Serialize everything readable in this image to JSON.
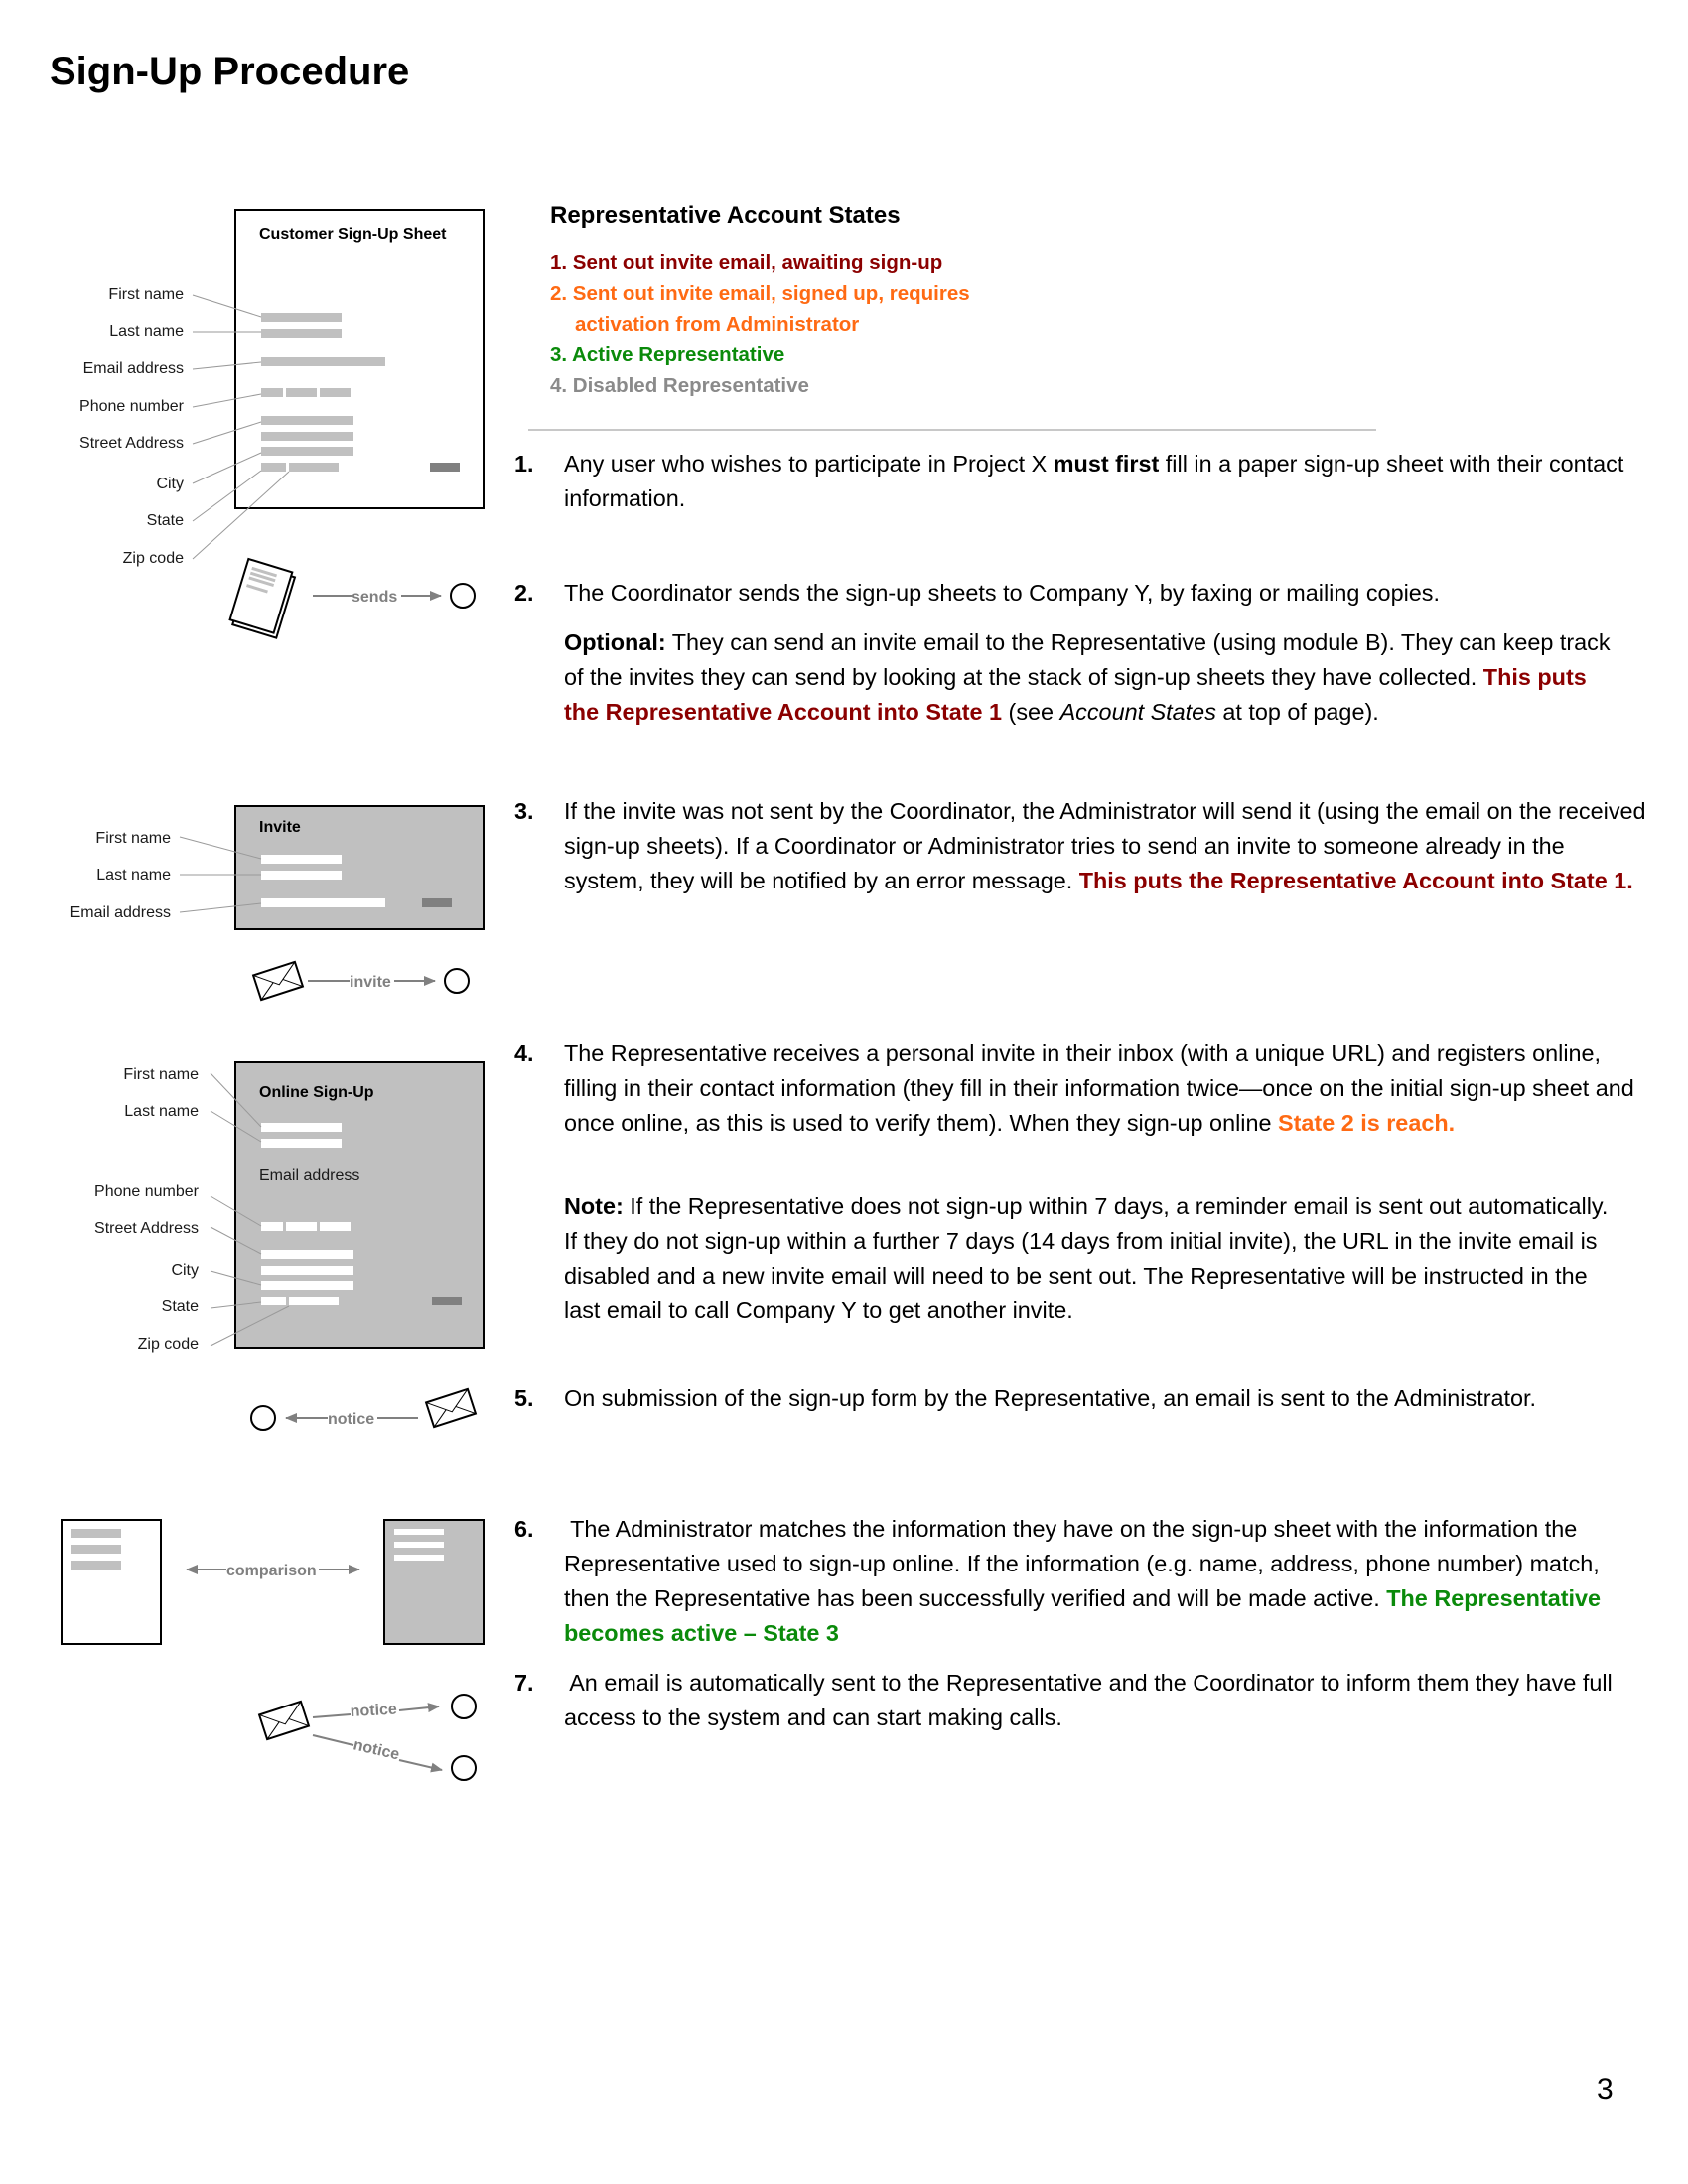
{
  "page": {
    "title": "Sign-Up Procedure",
    "page_number": "3"
  },
  "account_states": {
    "heading": "Representative Account States",
    "items": [
      {
        "text": "1. Sent out invite email, awaiting sign-up",
        "color": "#8b0000"
      },
      {
        "text_line1": "2. Sent out invite email, signed up, requires",
        "text_line2": "activation from Administrator",
        "color": "#ff6a13"
      },
      {
        "text": "3. Active Representative",
        "color": "#0a8a0a"
      },
      {
        "text": "4. Disabled Representative",
        "color": "#8a8a8a"
      }
    ]
  },
  "steps": [
    {
      "number": "1.",
      "text_before": "Any user who wishes to participate in Project X ",
      "bold": "must first",
      "text_after": " fill in a paper sign-up sheet with their contact information."
    },
    {
      "number": "2.",
      "text": "The Coordinator sends the sign-up sheets to Company Y, by faxing or mailing copies.",
      "optional_label": "Optional:",
      "optional_text": " They can send an invite email to the Representative (using module B). They can keep track of the invites they can send by looking at the stack of sign-up sheets they have collected. ",
      "optional_highlight": "This puts the Representative Account into State 1",
      "optional_after": " (see ",
      "optional_italic": "Account States",
      "optional_end": " at top of page)."
    },
    {
      "number": "3.",
      "text": "If the invite was not sent by the Coordinator, the Administrator will send it (using the email on the received sign-up sheets). If a Coordinator or Administrator tries to send an invite to someone already in the system, they will be notified by an error message. ",
      "highlight": "This puts the Representative Account into State 1."
    },
    {
      "number": "4.",
      "text": "The Representative receives a personal invite in their inbox (with a unique URL) and registers online, filling in their contact information (they fill in their information twice—once on the initial sign-up sheet and once online, as this is used to verify them). When they sign-up online ",
      "highlight": "State 2 is reach.",
      "note_label": "Note:",
      "note_text": " If the Representative does not sign-up within 7 days, a reminder email is sent out automatically. If they do not sign-up within a further 7 days (14 days from initial invite), the URL in the invite email is disabled and a new invite email will need to be sent out. The Representative will be instructed in the last email to call Company Y to get another invite."
    },
    {
      "number": "5.",
      "text": "On submission of the sign-up form by the Representative, an email is sent to the Administrator."
    },
    {
      "number": "6.",
      "text": " The Administrator matches the information they have on the sign-up sheet with the information the Representative used to sign-up online. If the information (e.g. name, address, phone number) match, then the Representative has been successfully verified and will be made active. ",
      "highlight": "The Representative becomes active – State 3"
    },
    {
      "number": "7.",
      "text": " An email is automatically sent to the Representative and the Coordinator to inform them they have full access to the system and can start making calls."
    }
  ],
  "diagrams": {
    "customer_sheet": {
      "title": "Customer Sign-Up Sheet",
      "labels": [
        "First name",
        "Last name",
        "Email address",
        "Phone number",
        "Street Address",
        "City",
        "State",
        "Zip code"
      ]
    },
    "sends_arrow": {
      "label": "sends",
      "icon": "document-stack-icon"
    },
    "invite_form": {
      "title": "Invite",
      "labels": [
        "First name",
        "Last name",
        "Email address"
      ]
    },
    "invite_arrow": {
      "label": "invite",
      "icon": "envelope-icon"
    },
    "online_signup": {
      "title": "Online Sign-Up",
      "inner_label": "Email address",
      "labels": [
        "First name",
        "Last name",
        "Phone number",
        "Street Address",
        "City",
        "State",
        "Zip code"
      ]
    },
    "notice_arrow": {
      "label": "notice",
      "icon": "envelope-icon"
    },
    "comparison_arrow": {
      "label": "comparison"
    },
    "final_notices": {
      "labels": [
        "notice",
        "notice"
      ],
      "icon": "envelope-icon"
    }
  },
  "colors": {
    "state1": "#8b0000",
    "state2": "#ff6a13",
    "state3": "#0a8a0a",
    "state4": "#8a8a8a",
    "field_gray": "#c0c0c0",
    "button_gray": "#808080",
    "arrow_gray": "#808080"
  }
}
